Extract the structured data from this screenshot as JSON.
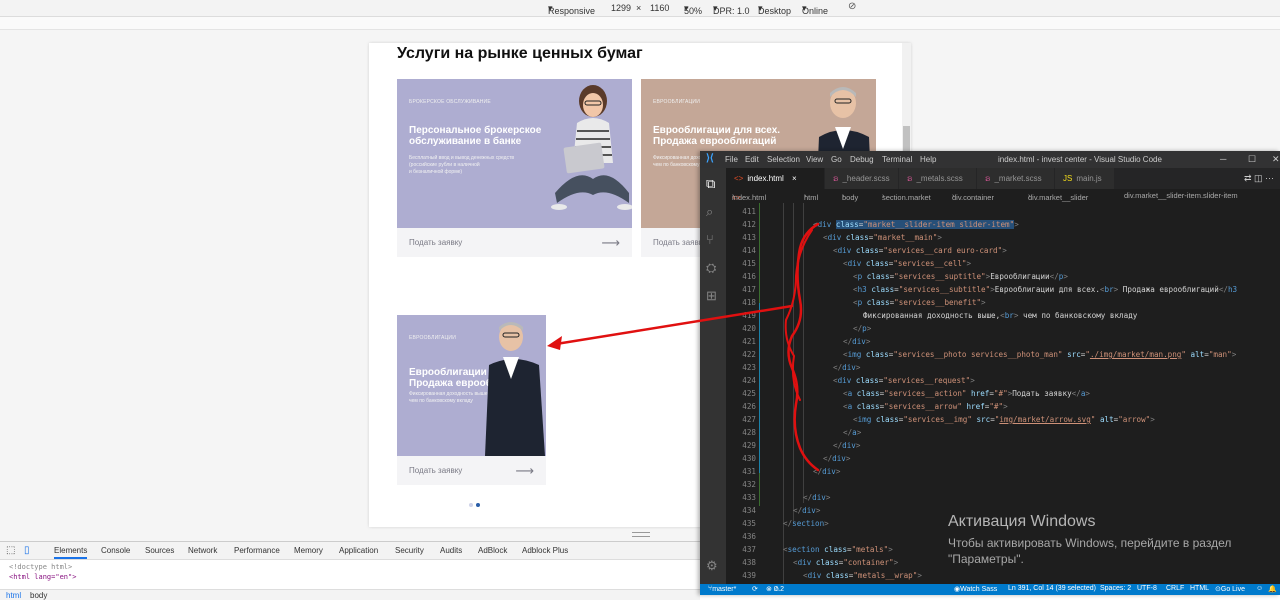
{
  "device_toolbar": {
    "mode": "Responsive",
    "width": "1299",
    "times": "×",
    "height": "1160",
    "zoom": "50%",
    "dpr": "DPR: 1.0",
    "device": "Desktop",
    "network": "Online"
  },
  "page": {
    "section_title": "Услуги на рынке ценных бумаг",
    "cards": [
      {
        "kicker": "Брокерское обслуживание",
        "title": "Персональное брокерское\nобслуживание в банке",
        "benefit": "Бесплатный ввод и вывод денежных средств\n(российские рубли в наличной\nи безналичной форме)",
        "request": "Подать заявку"
      },
      {
        "kicker": "Еврооблигации",
        "title": "Еврооблигации для всех.\nПродажа еврооблигаций",
        "benefit": "Фиксированная доходность выше,\nчем по банковскому вкладу",
        "request": "Подать заявку"
      },
      {
        "kicker": "Еврооблигации",
        "title": "Еврооблигации для всех.\nПродажа еврооблигаций",
        "benefit": "Фиксированная доходность выше,\nчем по банковскому вкладу",
        "request": "Подать заявку"
      }
    ],
    "colors": {
      "purple": "#aeadd1",
      "beige": "#c4a797",
      "accent": "#2a5ea8",
      "annotation": "#e01010"
    }
  },
  "devtools": {
    "tabs": [
      "Elements",
      "Console",
      "Sources",
      "Network",
      "Performance",
      "Memory",
      "Application",
      "Security",
      "Audits",
      "AdBlock",
      "Adblock Plus"
    ],
    "active_tab": "Elements",
    "code": [
      "<!doctype html>",
      "<html lang=\"en\">"
    ],
    "breadcrumbs": [
      "html",
      "body"
    ]
  },
  "vscode": {
    "menu": [
      "File",
      "Edit",
      "Selection",
      "View",
      "Go",
      "Debug",
      "Terminal",
      "Help"
    ],
    "window_title": "index.html - invest center - Visual Studio Code",
    "tabs": [
      {
        "label": "index.html",
        "type": "html",
        "close": "×"
      },
      {
        "label": "_header.scss",
        "type": "scss"
      },
      {
        "label": "_metals.scss",
        "type": "scss"
      },
      {
        "label": "_market.scss",
        "type": "scss"
      },
      {
        "label": "main.js",
        "type": "js"
      }
    ],
    "breadcrumbs": [
      "index.html",
      "html",
      "body",
      "section.market",
      "div.container",
      "div.market__slider",
      "div.market__slider-item.slider-item"
    ],
    "line_numbers": [
      "411",
      "412",
      "413",
      "414",
      "415",
      "416",
      "417",
      "418",
      "419",
      "420",
      "421",
      "422",
      "423",
      "424",
      "425",
      "426",
      "427",
      "428",
      "429",
      "430",
      "431",
      "432",
      "433",
      "434",
      "435",
      "436",
      "437",
      "438",
      "439"
    ],
    "status": {
      "branch": "master*",
      "errors": "0",
      "warnings": "2",
      "watch": "Watch Sass",
      "position": "Ln 391, Col 14 (39 selected)",
      "spaces": "Spaces: 2",
      "encoding": "UTF-8",
      "eol": "CRLF",
      "language": "HTML",
      "golive": "Go Live"
    },
    "activation": {
      "heading": "Активация Windows",
      "line1": "Чтобы активировать Windows, перейдите в раздел",
      "line2": "\"Параметры\"."
    }
  }
}
